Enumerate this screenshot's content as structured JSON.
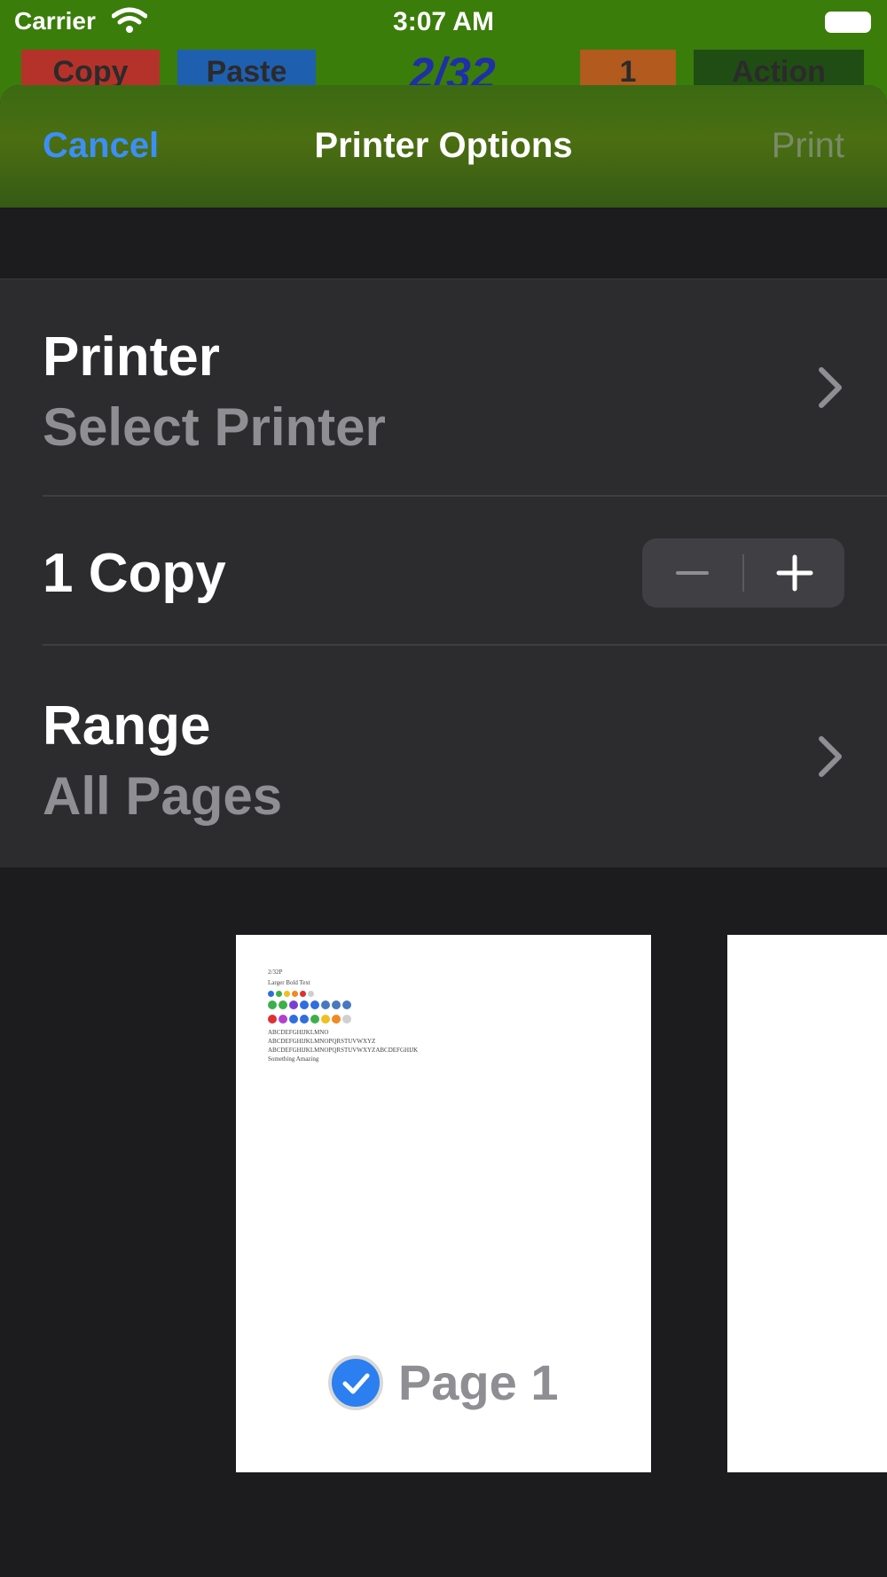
{
  "status_bar": {
    "carrier": "Carrier",
    "time": "3:07 AM"
  },
  "app": {
    "copy_label": "Copy",
    "paste_label": "Paste",
    "page_counter": "2/32",
    "count_label": "1",
    "action_label": "Action"
  },
  "sheet": {
    "cancel_label": "Cancel",
    "title": "Printer Options",
    "print_label": "Print"
  },
  "options": {
    "printer": {
      "title": "Printer",
      "value": "Select Printer"
    },
    "copies": {
      "label": "1 Copy",
      "minus": "−",
      "plus": "+"
    },
    "range": {
      "title": "Range",
      "value": "All Pages"
    }
  },
  "preview": {
    "page_label": "Page 1",
    "page_selected": true,
    "page_lines": [
      "2/32P",
      "Larger Bold Text",
      "ABCDEFGHIJKLMNO",
      "ABCDEFGHIJKLMNOPQRSTUVWXYZ",
      "ABCDEFGHIJKLMNOPQRSTUVWXYZABCDEFGHIJK",
      "Something Amazing"
    ]
  },
  "colors": {
    "accent": "#3d8ff5",
    "app_bar": "#3a7d0a",
    "sheet_bg": "#1c1c1e",
    "row_bg": "#2c2c2e",
    "secondary_text": "#8e8e93"
  }
}
